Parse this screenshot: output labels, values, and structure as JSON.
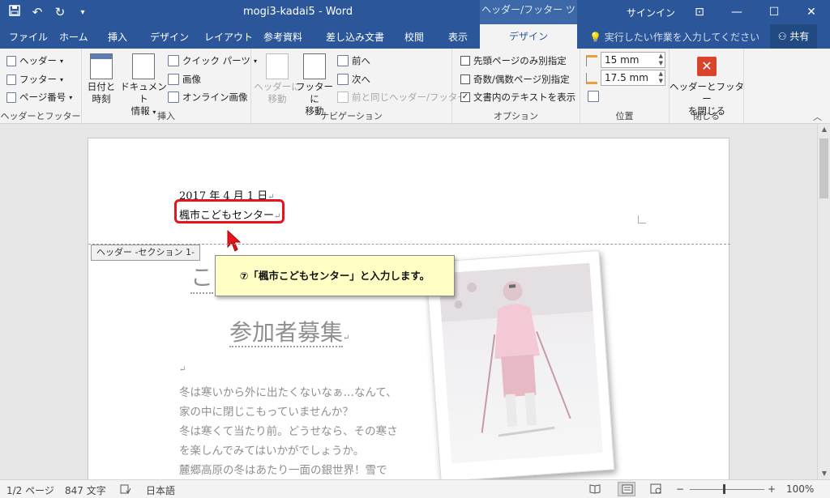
{
  "titlebar": {
    "qat_save_icon": "save-icon",
    "qat_undo": "↶",
    "qat_redo": "↻",
    "qat_customize": "▾",
    "doc_title": "mogi3-kadai5  -  Word",
    "contextual_tab": "ヘッダー/フッター ツール",
    "signin": "サインイン",
    "ribbon_display": "⊡",
    "minimize": "—",
    "maximize": "☐",
    "close": "✕"
  },
  "tabs": {
    "file": "ファイル",
    "home": "ホーム",
    "insert": "挿入",
    "design": "デザイン",
    "layout": "レイアウト",
    "references": "参考資料",
    "mailings": "差し込み文書",
    "review": "校閲",
    "view": "表示",
    "hf_design": "デザイン",
    "tell_me": "実行したい作業を入力してください",
    "share": "共有"
  },
  "ribbon": {
    "hf_group": {
      "header": "ヘッダー",
      "footer": "フッター",
      "page_number": "ページ番号",
      "label": "ヘッダーとフッター"
    },
    "insert_group": {
      "date_time": [
        "日付と",
        "時刻"
      ],
      "doc_info": [
        "ドキュメント",
        "情報"
      ],
      "quick_parts": "クイック パーツ",
      "picture": "画像",
      "online_picture": "オンライン画像",
      "label": "挿入"
    },
    "nav_group": {
      "goto_header": [
        "ヘッダーに",
        "移動"
      ],
      "goto_footer": [
        "フッターに",
        "移動"
      ],
      "previous": "前へ",
      "next": "次へ",
      "link_previous": "前と同じヘッダー/フッター",
      "label": "ナビゲーション"
    },
    "options_group": {
      "different_first": "先頭ページのみ別指定",
      "odd_even": "奇数/偶数ページ別指定",
      "show_text": "文書内のテキストを表示",
      "label": "オプション"
    },
    "position_group": {
      "header_pos": "15 mm",
      "footer_pos": "17.5 mm",
      "label": "位置"
    },
    "close_group": {
      "close_label": [
        "ヘッダーとフッター",
        "を閉じる"
      ],
      "label": "閉じる"
    },
    "collapse": "︿"
  },
  "document": {
    "header_date": "2017 年 4 月 1 日",
    "header_org": "楓市こどもセンター",
    "header_tag": "ヘッダー -セクション 1-",
    "body_heading_partial": "こ",
    "body_title": "参加者募集",
    "body_lines": [
      "冬は寒いから外に出たくないなぁ…なんて、",
      "家の中に閉じこもっていませんか？",
      "冬は寒くて当たり前。どうせなら、その寒さ",
      "を楽しんでみてはいかがでしょうか。",
      "麓郷高原の冬はあたり一面の銀世界！雪で"
    ],
    "return_mark": "↵",
    "callout": "⑦「楓市こどもセンター」と入力します。"
  },
  "statusbar": {
    "page": "1/2 ページ",
    "words": "847 文字",
    "language": "日本語",
    "zoom": "100%",
    "zoom_level_percent": 100
  },
  "colors": {
    "accent": "#2b579a",
    "highlight_red": "#e8141b",
    "callout_bg": "#ffffc5"
  }
}
